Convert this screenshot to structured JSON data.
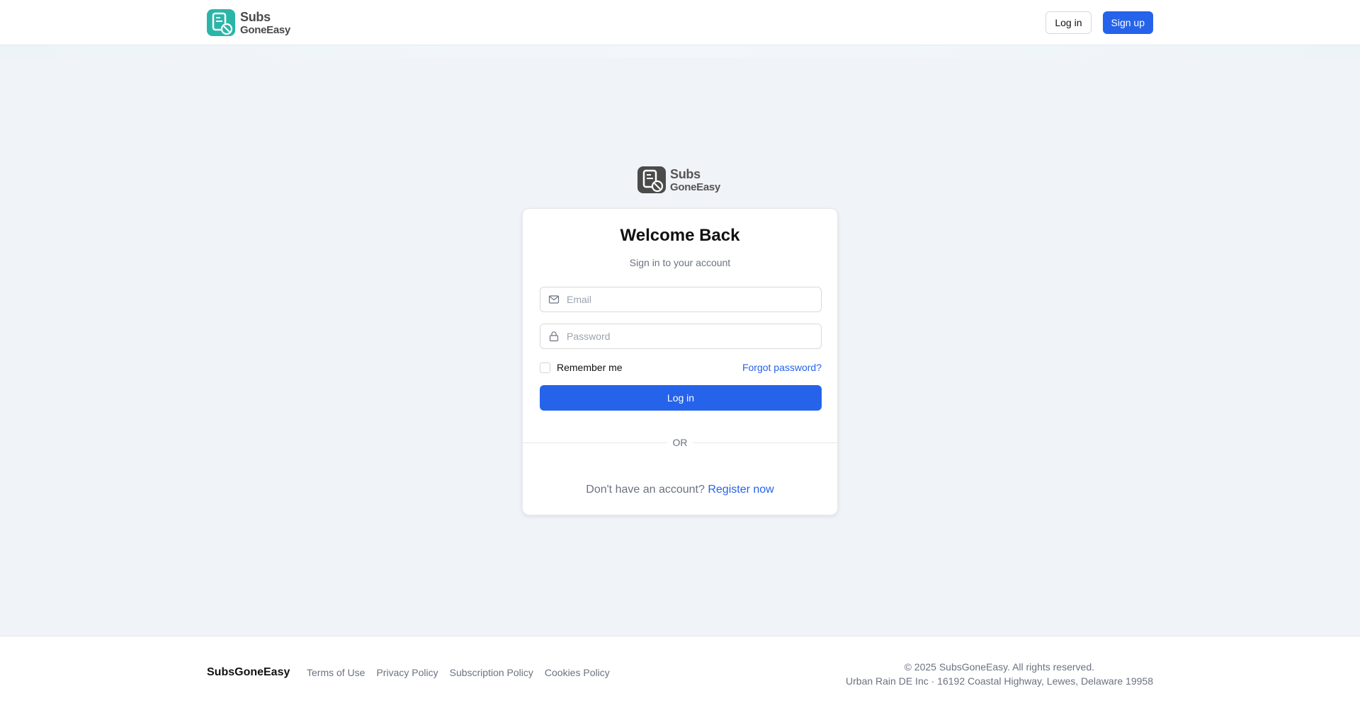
{
  "header": {
    "logo_line1": "Subs",
    "logo_line2": "GoneEasy",
    "login_label": "Log in",
    "signup_label": "Sign up"
  },
  "auth": {
    "logo_line1": "Subs",
    "logo_line2": "GoneEasy",
    "title": "Welcome Back",
    "subtitle": "Sign in to your account",
    "email_placeholder": "Email",
    "password_placeholder": "Password",
    "remember_label": "Remember me",
    "forgot_label": "Forgot password?",
    "login_label": "Log in",
    "divider_label": "OR",
    "register_prompt": "Don't have an account?",
    "register_link": "Register now"
  },
  "footer": {
    "brand": "SubsGoneEasy",
    "links": [
      "Terms of Use",
      "Privacy Policy",
      "Subscription Policy",
      "Cookies Policy"
    ],
    "copyright": "© 2025 SubsGoneEasy. All rights reserved.",
    "address": "Urban Rain DE Inc · 16192 Coastal Highway, Lewes, Delaware 19958"
  },
  "icons": {
    "header_logo": "document-cancel-icon",
    "email": "mail-icon",
    "password": "lock-icon"
  },
  "colors": {
    "primary": "#2563eb",
    "logo_teal": "#2bb5a8",
    "background": "#f0f3f7"
  }
}
